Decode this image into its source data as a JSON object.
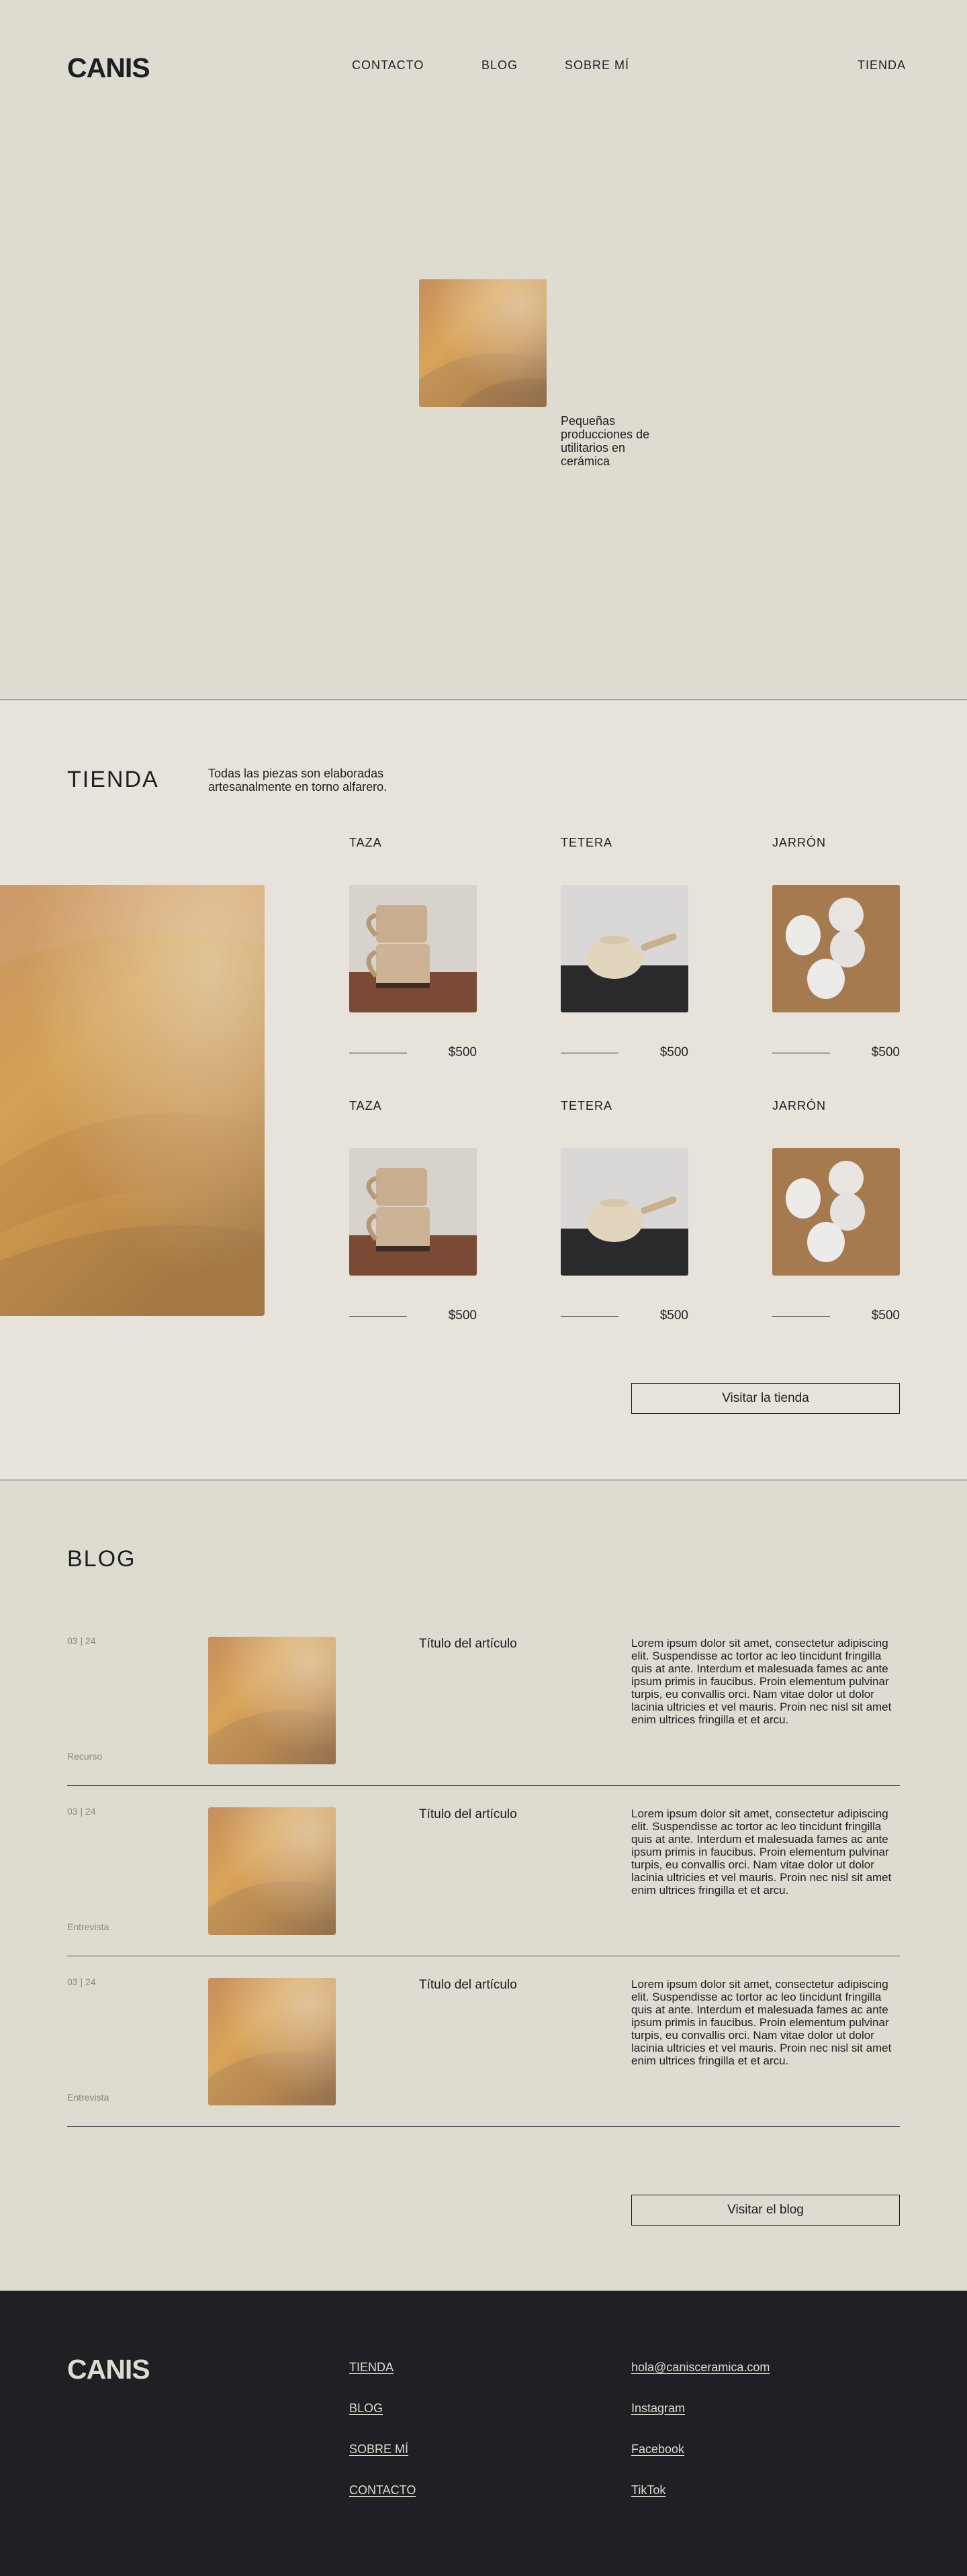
{
  "brand": {
    "logo": "CANIS"
  },
  "nav": {
    "contacto": "CONTACTO",
    "blog": "BLOG",
    "sobre": "SOBRE MÍ",
    "tienda": "TIENDA"
  },
  "hero": {
    "tagline": "Pequeñas producciones de utilitarios en cerámica"
  },
  "tienda": {
    "title": "TIENDA",
    "intro": "Todas las piezas son elaboradas artesanalmente en torno alfarero.",
    "products": [
      {
        "name": "TAZA",
        "price": "$500",
        "icon": "mugs-photo"
      },
      {
        "name": "TETERA",
        "price": "$500",
        "icon": "teapot-photo"
      },
      {
        "name": "JARRÓN",
        "price": "$500",
        "icon": "vases-photo"
      },
      {
        "name": "TAZA",
        "price": "$500",
        "icon": "mugs-photo"
      },
      {
        "name": "TETERA",
        "price": "$500",
        "icon": "teapot-photo"
      },
      {
        "name": "JARRÓN",
        "price": "$500",
        "icon": "vases-photo"
      }
    ],
    "button": "Visitar la tienda"
  },
  "blog": {
    "title": "BLOG",
    "posts": [
      {
        "date": "03 | 24",
        "category": "Recurso",
        "title": "Título del artículo",
        "excerpt": "Lorem ipsum dolor sit amet, consectetur adipiscing elit. Suspendisse ac tortor ac leo tincidunt fringilla quis at ante. Interdum et malesuada fames ac ante ipsum primis in faucibus. Proin elementum pulvinar turpis, eu convallis orci. Nam vitae dolor ut dolor lacinia ultricies et vel mauris. Proin nec nisl sit amet enim ultrices fringilla et et arcu."
      },
      {
        "date": "03 | 24",
        "category": "Entrevista",
        "title": "Título del artículo",
        "excerpt": "Lorem ipsum dolor sit amet, consectetur adipiscing elit. Suspendisse ac tortor ac leo tincidunt fringilla quis at ante. Interdum et malesuada fames ac ante ipsum primis in faucibus. Proin elementum pulvinar turpis, eu convallis orci. Nam vitae dolor ut dolor lacinia ultricies et vel mauris. Proin nec nisl sit amet enim ultrices fringilla et et arcu."
      },
      {
        "date": "03 | 24",
        "category": "Entrevista",
        "title": "Título del artículo",
        "excerpt": "Lorem ipsum dolor sit amet, consectetur adipiscing elit. Suspendisse ac tortor ac leo tincidunt fringilla quis at ante. Interdum et malesuada fames ac ante ipsum primis in faucibus. Proin elementum pulvinar turpis, eu convallis orci. Nam vitae dolor ut dolor lacinia ultricies et vel mauris. Proin nec nisl sit amet enim ultrices fringilla et et arcu."
      }
    ],
    "button": "Visitar el blog"
  },
  "footer": {
    "logo": "CANIS",
    "links": [
      "TIENDA",
      "BLOG",
      "SOBRE MÍ",
      "CONTACTO"
    ],
    "contact": [
      "hola@canisceramica.com",
      "Instagram",
      "Facebook",
      "TikTok"
    ]
  },
  "colors": {
    "background": "#dedbd0",
    "tienda_background": "#e7e3db",
    "text": "#1f1e22",
    "footer": "#202024"
  }
}
